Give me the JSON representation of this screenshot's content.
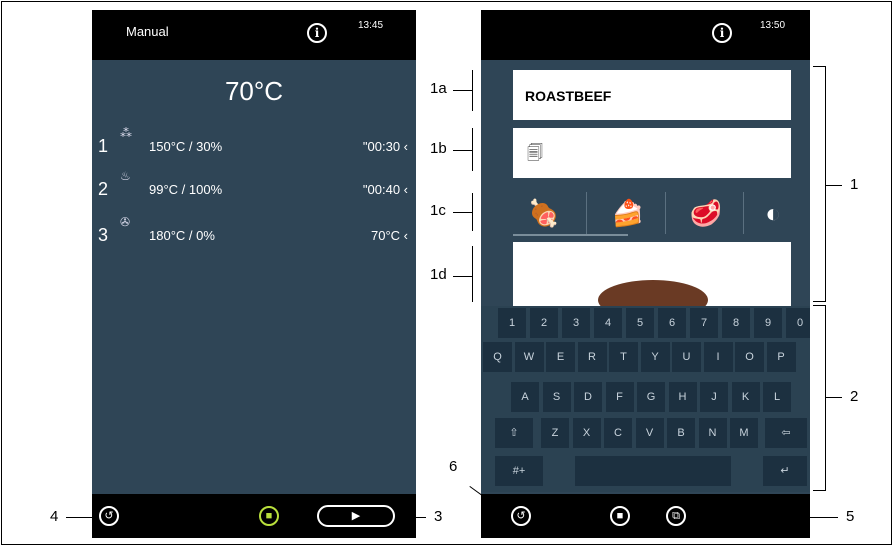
{
  "left_screen": {
    "title": "Manual",
    "time": "13:45",
    "main_temp": "70°C",
    "steps": [
      {
        "num": "1",
        "value": "150°C / 30%",
        "time": "\"00:30 ‹"
      },
      {
        "num": "2",
        "value": "99°C / 100%",
        "time": "\"00:40 ‹"
      },
      {
        "num": "3",
        "value": "180°C / 0%",
        "time": "70°C  ‹"
      }
    ]
  },
  "right_screen": {
    "time": "13:50",
    "name_field": "ROASTBEEF",
    "keyboard": {
      "row1": [
        "1",
        "2",
        "3",
        "4",
        "5",
        "6",
        "7",
        "8",
        "9",
        "0"
      ],
      "row2": [
        "Q",
        "W",
        "E",
        "R",
        "T",
        "Y",
        "U",
        "I",
        "O",
        "P"
      ],
      "row3": [
        "A",
        "S",
        "D",
        "F",
        "G",
        "H",
        "J",
        "K",
        "L"
      ],
      "row4": [
        "Z",
        "X",
        "C",
        "V",
        "B",
        "N",
        "M"
      ],
      "symbols": "#+",
      "shift": "⇧",
      "backspace": "⇦",
      "enter": "↵"
    }
  },
  "callouts": {
    "l1a": "1a",
    "l1b": "1b",
    "l1c": "1c",
    "l1d": "1d",
    "l1": "1",
    "l2": "2",
    "l3": "3",
    "l4": "4",
    "l5": "5",
    "l6": "6"
  },
  "colors": {
    "screen_bg": "#2f4556",
    "highlight": "#b9e03c",
    "key_bg": "#1c3040"
  }
}
